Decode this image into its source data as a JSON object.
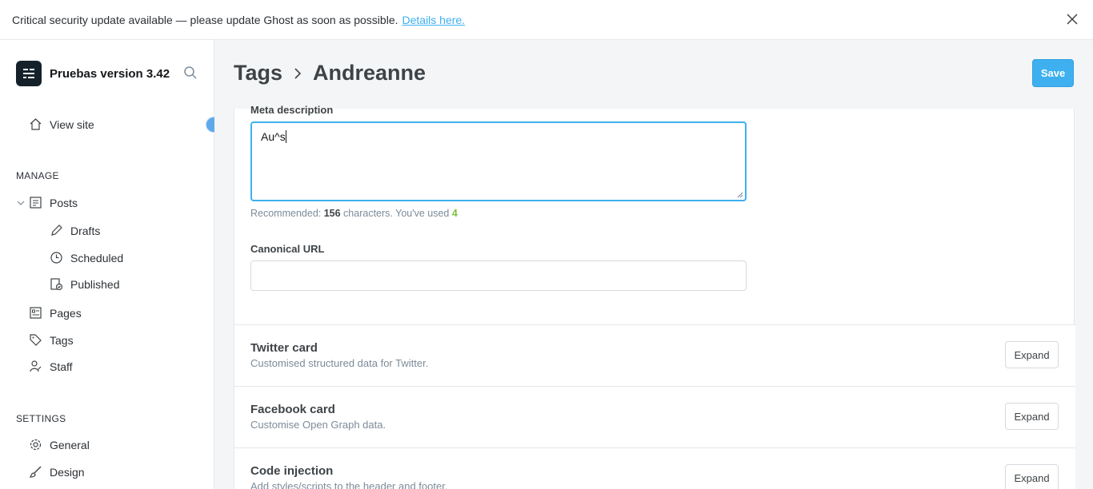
{
  "banner": {
    "message": "Critical security update available — please update Ghost as soon as possible.",
    "link_label": "Details here."
  },
  "sidebar": {
    "site_title": "Pruebas version 3.42",
    "view_site": "View site",
    "manage_label": "MANAGE",
    "posts": "Posts",
    "drafts": "Drafts",
    "scheduled": "Scheduled",
    "published": "Published",
    "pages": "Pages",
    "tags": "Tags",
    "staff": "Staff",
    "settings_label": "SETTINGS",
    "general": "General",
    "design": "Design"
  },
  "header": {
    "crumb_parent": "Tags",
    "crumb_current": "Andreanne",
    "save_label": "Save"
  },
  "meta": {
    "label": "Meta description",
    "value": "Au^s",
    "hint_prefix": "Recommended: ",
    "recommended": "156",
    "hint_middle": " characters. You've used ",
    "used": "4"
  },
  "canonical": {
    "label": "Canonical URL",
    "value": ""
  },
  "cards": [
    {
      "title": "Twitter card",
      "desc": "Customised structured data for Twitter.",
      "button": "Expand"
    },
    {
      "title": "Facebook card",
      "desc": "Customise Open Graph data.",
      "button": "Expand"
    },
    {
      "title": "Code injection",
      "desc": "Add styles/scripts to the header and footer.",
      "button": "Expand"
    }
  ],
  "colors": {
    "accent": "#3eb0ef",
    "used_count": "#7bc03a"
  }
}
